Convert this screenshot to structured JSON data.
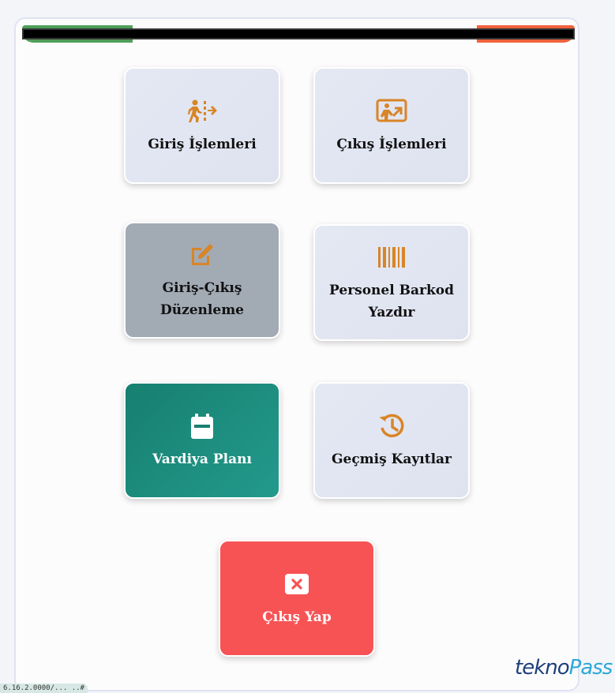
{
  "tiles": [
    {
      "id": "entry",
      "label": "Giriş İşlemleri",
      "icon": "person-entering-icon"
    },
    {
      "id": "exit",
      "label": "Çıkış İşlemleri",
      "icon": "person-exiting-icon"
    },
    {
      "id": "edit",
      "label": "Giriş-Çıkış Düzenleme",
      "icon": "edit-icon"
    },
    {
      "id": "barcode",
      "label": "Personel Barkod Yazdır",
      "icon": "barcode-icon"
    },
    {
      "id": "shift",
      "label": "Vardiya Planı",
      "icon": "calendar-icon"
    },
    {
      "id": "history",
      "label": "Geçmiş Kayıtlar",
      "icon": "history-icon"
    },
    {
      "id": "logout",
      "label": "Çıkış Yap",
      "icon": "close-box-icon"
    }
  ],
  "logo": {
    "part1": "tekno",
    "part2": "Pass"
  },
  "status_text": "6.16.2.0000/... ..#",
  "colors": {
    "accent": "#d88527",
    "teal": "#167f70",
    "red": "#f75355",
    "gray": "#a2aab4"
  }
}
